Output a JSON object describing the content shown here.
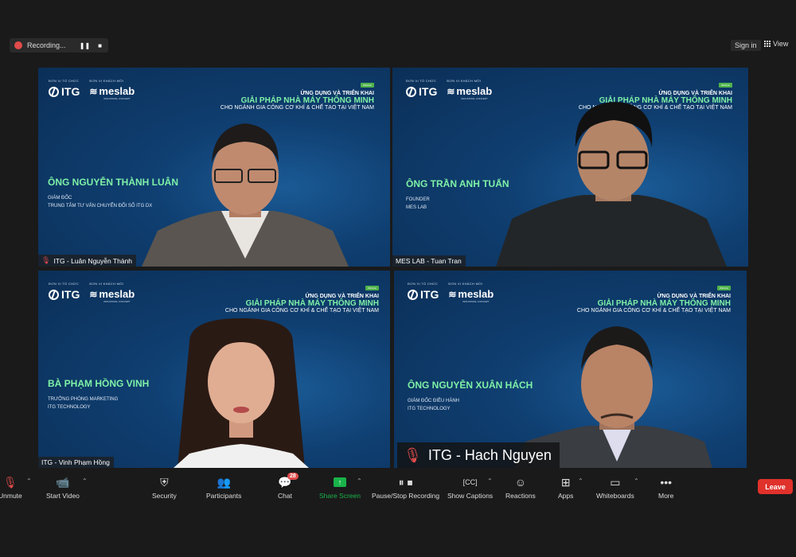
{
  "recording": {
    "label": "Recording..."
  },
  "top_right": {
    "signin": "Sign in",
    "view": "View"
  },
  "banner": {
    "org_caption": "ĐƠN VỊ TỔ CHỨC",
    "guest_caption": "ĐƠN VỊ KHÁCH MỜI",
    "itg": "ITG",
    "meslab": "meslab",
    "meslab_sub": "INDUSTRIAL CONCEPT",
    "badge": "Webinar",
    "line1": "ỨNG DỤNG VÀ TRIỂN KHAI",
    "line2": "GIẢI PHÁP NHÀ MÁY THÔNG MINH",
    "line3": "CHO NGÀNH GIA CÔNG CƠ KHÍ & CHẾ TẠO TẠI VIỆT NAM"
  },
  "tiles": [
    {
      "speaker": "ÔNG NGUYỄN THÀNH LUÂN",
      "role1": "GIÁM ĐỐC",
      "role2": "TRUNG TÂM TƯ VẤN CHUYỂN ĐỔI SỐ ITG DX",
      "label": "ITG - Luân Nguyễn Thành"
    },
    {
      "speaker": "ÔNG TRẦN ANH TUẤN",
      "role1": "FOUNDER",
      "role2": "MES LAB",
      "label": "MES LAB - Tuan Tran"
    },
    {
      "speaker": "BÀ PHẠM HỒNG VINH",
      "role1": "TRƯỞNG PHÒNG MARKETING",
      "role2": "ITG TECHNOLOGY",
      "label": "ITG - Vinh Phạm Hồng"
    },
    {
      "speaker": "ÔNG NGUYỄN XUÂN HÁCH",
      "role1": "GIÁM ĐỐC ĐIỀU HÀNH",
      "role2": "ITG TECHNOLOGY",
      "label": "ITG - Hach Nguyen"
    }
  ],
  "toolbar": {
    "unmute": "Unmute",
    "start_video": "Start Video",
    "security": "Security",
    "participants": "Participants",
    "chat": "Chat",
    "chat_count": "28",
    "share": "Share Screen",
    "pause_rec": "Pause/Stop Recording",
    "captions": "Show Captions",
    "reactions": "Reactions",
    "apps": "Apps",
    "whiteboards": "Whiteboards",
    "more": "More",
    "leave": "Leave"
  },
  "colors": {
    "accent_green": "#7ef1a7",
    "active_border": "#c9e56a",
    "leave_red": "#e0312b",
    "share_green": "#19b34a"
  }
}
